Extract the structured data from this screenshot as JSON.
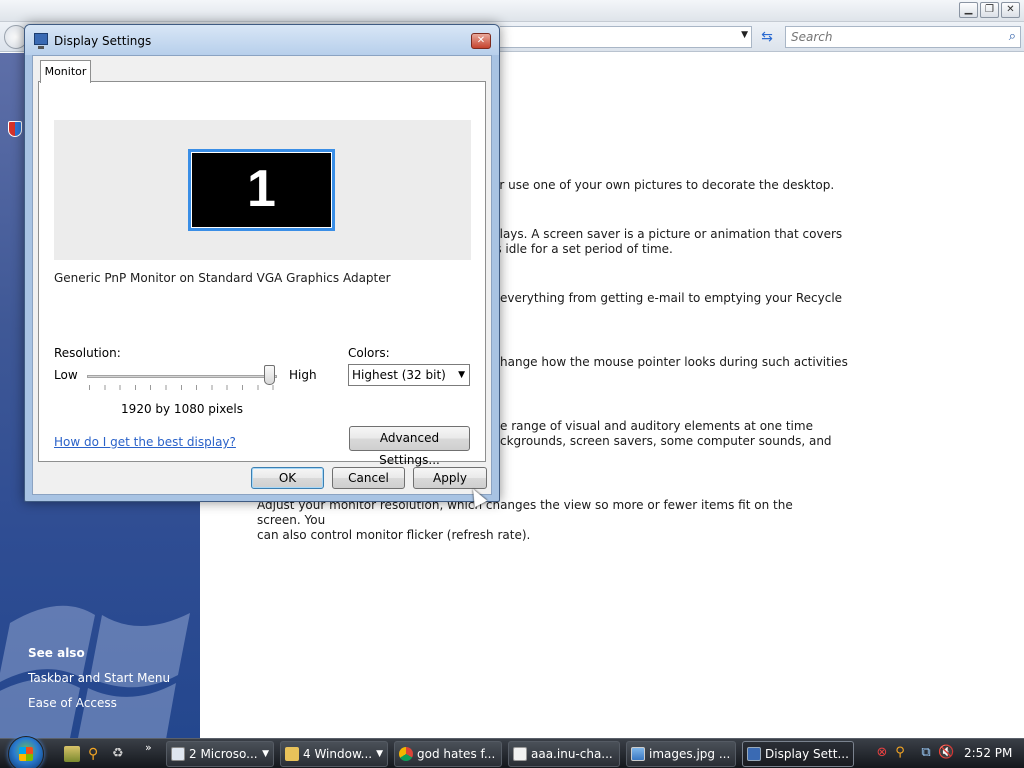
{
  "control_panel": {
    "search_placeholder": "Search",
    "sidebar": {
      "see_also": "See also",
      "links": [
        "Taskbar and Start Menu",
        "Ease of Access"
      ]
    },
    "paragraphs": [
      {
        "lines": [
          "or use one of your own pictures to decorate the desktop."
        ]
      },
      {
        "lines": [
          "plays. A screen saver is a picture or animation that covers",
          "is idle for a set period of time."
        ]
      },
      {
        "lines": [
          "everything from getting e-mail to emptying your Recycle"
        ]
      },
      {
        "lines": [
          "hange how the mouse pointer looks during such activities"
        ]
      },
      {
        "lines": [
          "e range of visual and auditory elements at one time",
          "ckgrounds, screen savers, some computer sounds, and"
        ]
      },
      {
        "lines": [
          "Adjust your monitor resolution, which changes the view so more or fewer items fit on the screen. You",
          "can also control monitor flicker (refresh rate)."
        ]
      }
    ]
  },
  "dialog": {
    "title": "Display Settings",
    "close_glyph": "✕",
    "tab_label": "Monitor",
    "monitor_number": "1",
    "monitor_name": "Generic PnP Monitor on Standard VGA Graphics Adapter",
    "resolution_label": "Resolution:",
    "low_label": "Low",
    "high_label": "High",
    "resolution_value": "1920 by 1080 pixels",
    "slider_level": 1.0,
    "colors_label": "Colors:",
    "colors_value": "Highest (32 bit)",
    "help_link": "How do I get the best display?",
    "advanced_button": "Advanced Settings...",
    "ok_button": "OK",
    "cancel_button": "Cancel",
    "apply_button": "Apply"
  },
  "taskbar": {
    "more_glyph": "»",
    "buttons": [
      {
        "label": "2 Microso...",
        "icon": "window-group-icon",
        "has_arrow": true
      },
      {
        "label": "4 Window...",
        "icon": "folder-icon",
        "has_arrow": true
      },
      {
        "label": "god hates f...",
        "icon": "chrome-icon",
        "has_arrow": false
      },
      {
        "label": "aaa.inu-cha...",
        "icon": "document-icon",
        "has_arrow": false
      },
      {
        "label": "images.jpg ...",
        "icon": "image-icon",
        "has_arrow": false
      },
      {
        "label": "Display Sett...",
        "icon": "display-settings-icon",
        "has_arrow": false
      }
    ],
    "clock": "2:52 PM"
  },
  "colors": {
    "sidebar_top": "#5e6fa8",
    "sidebar_bottom": "#24478e",
    "monitor_border": "#3a8ee6",
    "link": "#2a62c9",
    "dialog_frame": "#a8c3e3"
  }
}
